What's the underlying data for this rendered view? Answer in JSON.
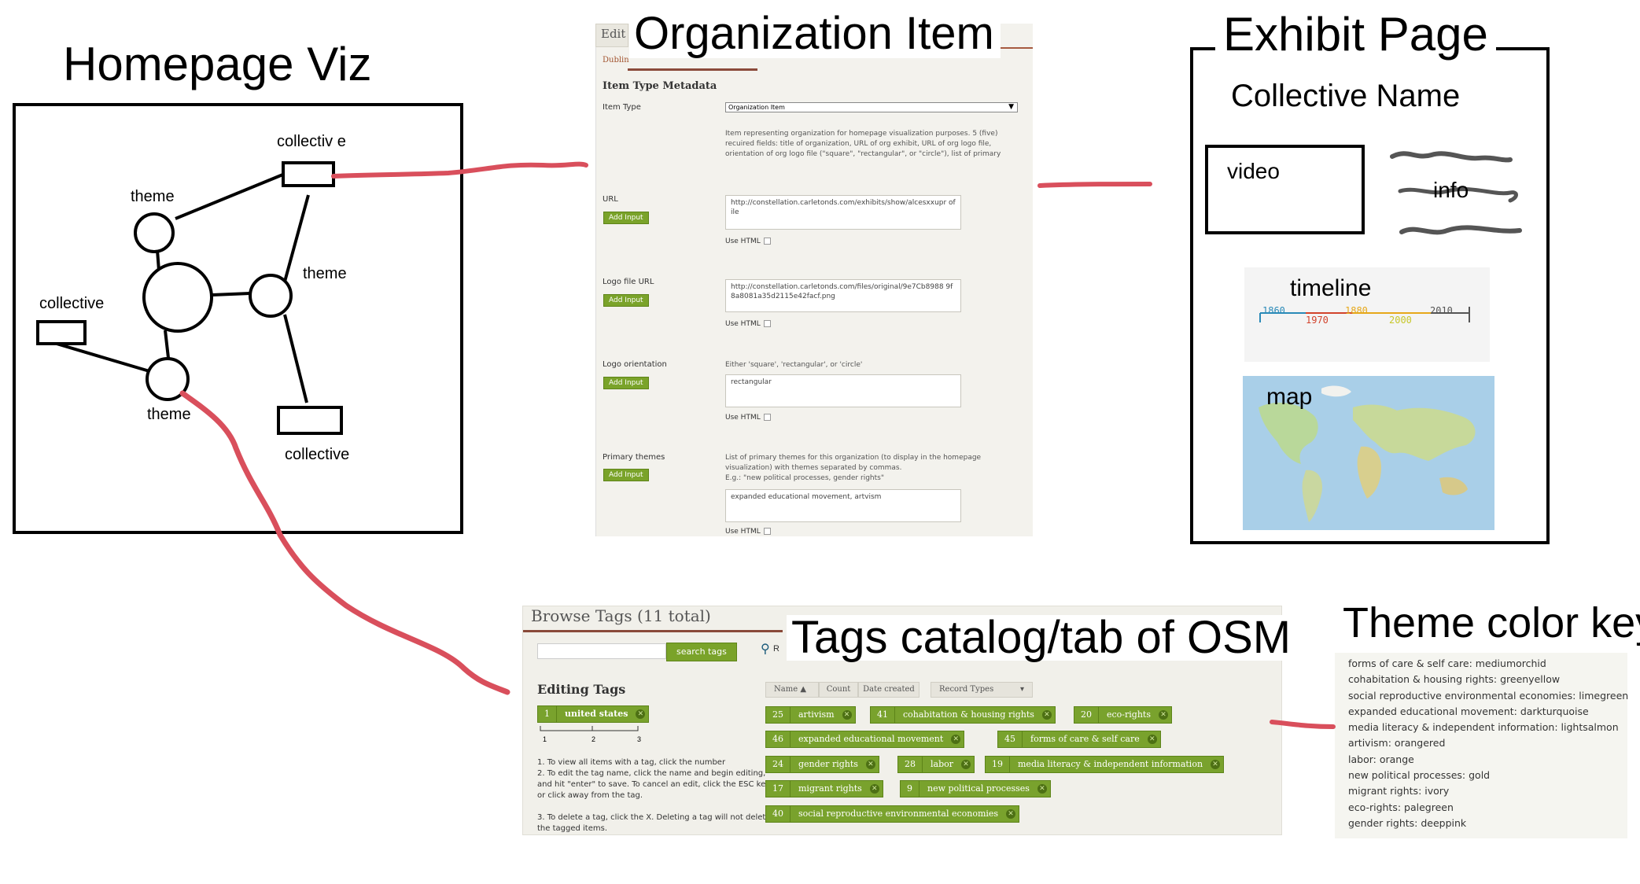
{
  "titles": {
    "homepage": "Homepage Viz",
    "organization": "Organization Item",
    "exhibit": "Exhibit Page",
    "tags": "Tags catalog/tab of OSM",
    "theme_key": "Theme color key"
  },
  "homepage_sketch": {
    "labels": {
      "collective_top": "collectiv e",
      "theme_left": "theme",
      "theme_right": "theme",
      "collective_left": "collective",
      "theme_bottom": "theme",
      "collective_bottom": "collective"
    }
  },
  "org_form": {
    "tab": "Edit",
    "subtab": "Dublin",
    "section_title": "Item Type Metadata",
    "item_type_label": "Item Type",
    "item_type_value": "Organization Item",
    "item_type_desc": "Item representing organization for homepage visualization purposes. 5 (five) recuired fields: title of organization, URL of org exhibit, URL of org logo file, orientation of org logo file (\"square\", \"rectangular\", or \"circle\"), list of primary themes.",
    "add_input": "Add Input",
    "use_html": "Use HTML",
    "fields": [
      {
        "label": "URL",
        "desc": "",
        "hint": "",
        "value": "http://constellation.carletonds.com/exhibits/show/alcesxxupr ofile"
      },
      {
        "label": "Logo file URL",
        "desc": "",
        "hint": "",
        "value": "http://constellation.carletonds.com/files/original/9e7Cb8988 9f8a8081a35d2115e42facf.png"
      },
      {
        "label": "Logo orientation",
        "desc": "Either 'square', 'rectangular', or 'circle'",
        "hint": "",
        "value": "rectangular"
      },
      {
        "label": "Primary themes",
        "desc": "List of primary themes for this organization (to display in the homepage visualization) with themes separated by commas.",
        "hint": "E.g.: \"new political processes, gender rights\"",
        "value": "expanded educational movement, artvism"
      }
    ]
  },
  "exhibit_page": {
    "collective_name": "Collective Name",
    "video": "video",
    "info": "info",
    "timeline": "timeline",
    "map": "map",
    "timeline_years": [
      "1860",
      "1970",
      "1880",
      "2000",
      "2010"
    ]
  },
  "tags_panel": {
    "header": "Browse Tags (11 total)",
    "search_button": "search tags",
    "search_icon_label": "R",
    "editing_title": "Editing Tags",
    "example_tag": {
      "count": "1",
      "name": "united states"
    },
    "example_numbers": [
      "1",
      "2",
      "3"
    ],
    "instructions": [
      "1. To view all items with a tag, click the number",
      "2. To edit the tag name, click the name and begin editing, and hit \"enter\" to save. To cancel an edit, click the ESC key or click away from the tag.",
      "3. To delete a tag, click the X. Deleting a tag will not delete the tagged items."
    ],
    "sort_buttons": [
      "Name",
      "Count",
      "Date created"
    ],
    "record_types": "Record Types",
    "tags": [
      {
        "count": "25",
        "name": "artivism"
      },
      {
        "count": "41",
        "name": "cohabitation & housing rights"
      },
      {
        "count": "20",
        "name": "eco-rights"
      },
      {
        "count": "46",
        "name": "expanded educational movement"
      },
      {
        "count": "45",
        "name": "forms of care & self care"
      },
      {
        "count": "24",
        "name": "gender rights"
      },
      {
        "count": "28",
        "name": "labor"
      },
      {
        "count": "19",
        "name": "media literacy & independent information"
      },
      {
        "count": "17",
        "name": "migrant rights"
      },
      {
        "count": "9",
        "name": "new political processes"
      },
      {
        "count": "40",
        "name": "social reproductive environmental economies"
      }
    ]
  },
  "theme_color_key": [
    "forms of care & self care: mediumorchid",
    "cohabitation & housing rights: greenyellow",
    "social reproductive environmental economies: limegreen",
    "expanded educational movement: darkturquoise",
    "media literacy & independent information: lightsalmon",
    "artivism: orangered",
    "labor: orange",
    "new political processes: gold",
    "migrant rights: ivory",
    "eco-rights: palegreen",
    "gender rights: deeppink"
  ],
  "colors": {
    "connector": "#d94f5c",
    "tag_green": "#79a22d",
    "panel_bg": "#f3f2ed"
  }
}
